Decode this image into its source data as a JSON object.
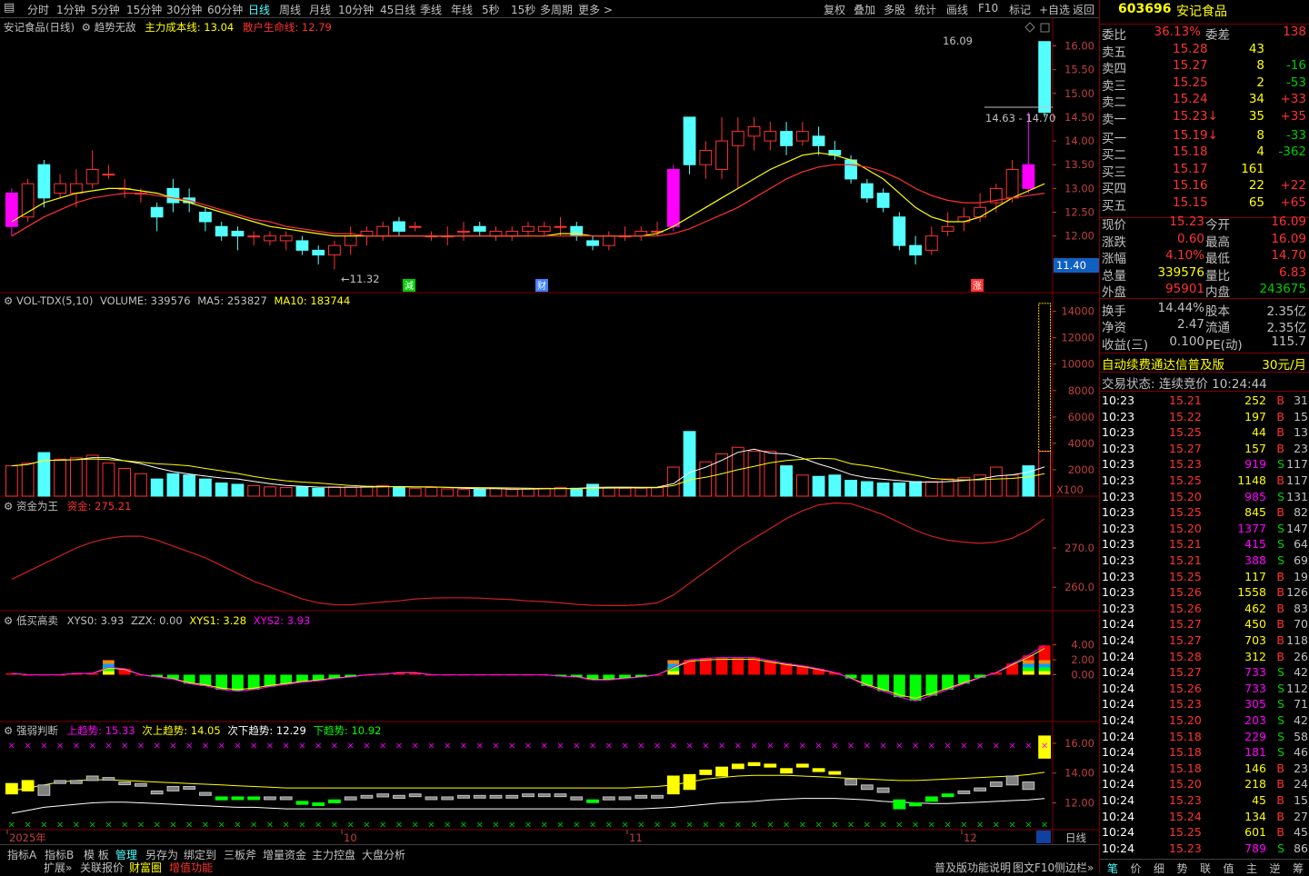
{
  "toolbar": {
    "periods": [
      "分时",
      "1分钟",
      "5分钟",
      "15分钟",
      "30分钟",
      "60分钟",
      "日线",
      "周线",
      "月线",
      "10分钟",
      "45日线",
      "季线",
      "年线",
      "5秒",
      "15秒",
      "多周期",
      "更多 >"
    ],
    "right": [
      "复权",
      "叠加",
      "多股",
      "统计",
      "画线",
      "F10",
      "标记",
      "+自选",
      "返回"
    ]
  },
  "main_panel": {
    "title": "安记食品(日线)",
    "indicator": "趋势无敌",
    "cost_line": "主力成本线: 13.04",
    "retail_line": "散户生命线: 12.79",
    "high_label": "16.09",
    "range_label": "14.63 - 14.70",
    "low_label": "←11.32",
    "price_box": "11.40",
    "markers": [
      "減",
      "财",
      "涨"
    ]
  },
  "vol_panel": {
    "title": "VOL-TDX(5,10)",
    "volume": "VOLUME: 339576",
    "ma5": "MA5: 253827",
    "ma10": "MA10: 183744",
    "unit": "X100"
  },
  "fund_panel": {
    "title": "资金为王",
    "fund": "资金: 275.21"
  },
  "low_panel": {
    "title": "低买高卖",
    "xys0": "XYS0: 3.93",
    "zzx": "ZZX: 0.00",
    "xys1": "XYS1: 3.28",
    "xys2": "XYS2: 3.93"
  },
  "strength_panel": {
    "title": "强弱判断",
    "up": "上趋势: 15.33",
    "next_up": "次上趋势: 14.05",
    "next_down": "次下趋势: 12.29",
    "down": "下趋势: 10.92"
  },
  "time_axis": {
    "labels": [
      "2025年",
      "10",
      "11",
      "12"
    ],
    "period": "日线"
  },
  "bottom_tabs": [
    "指标A",
    "指标B",
    "模 板",
    "管理",
    "另存为",
    "绑定到",
    "三板斧",
    "增量资金",
    "主力控盘",
    "大盘分析"
  ],
  "bottom_tabs2": [
    "扩展»",
    "关联报价",
    "财富圈",
    "增值功能"
  ],
  "bottom_right": [
    "普及版功能说明",
    "图文F10",
    "侧边栏»"
  ],
  "quote": {
    "code": "603696",
    "name": "安记食品",
    "webi": "委比",
    "webi_val": "36.13%",
    "weicha": "委差",
    "weicha_val": "138",
    "asks": [
      [
        "卖五",
        "15.28",
        "43",
        ""
      ],
      [
        "卖四",
        "15.27",
        "8",
        "-16"
      ],
      [
        "卖三",
        "15.25",
        "2",
        "-53"
      ],
      [
        "卖二",
        "15.24",
        "34",
        "+33"
      ],
      [
        "卖一",
        "15.23↓",
        "35",
        "+35"
      ]
    ],
    "bids": [
      [
        "买一",
        "15.19↓",
        "8",
        "-33"
      ],
      [
        "买二",
        "15.18",
        "4",
        "-362"
      ],
      [
        "买三",
        "15.17",
        "161",
        ""
      ],
      [
        "买四",
        "15.16",
        "22",
        "+22"
      ],
      [
        "买五",
        "15.15",
        "65",
        "+65"
      ]
    ],
    "stats": [
      [
        "现价",
        "15.23",
        "今开",
        "16.09"
      ],
      [
        "涨跌",
        "0.60",
        "最高",
        "16.09"
      ],
      [
        "涨幅",
        "4.10%",
        "最低",
        "14.70"
      ],
      [
        "总量",
        "339576",
        "量比",
        "6.83"
      ],
      [
        "外盘",
        "95901",
        "内盘",
        "243675"
      ]
    ],
    "stats2": [
      [
        "换手",
        "14.44%",
        "股本",
        "2.35亿"
      ],
      [
        "净资",
        "2.47",
        "流通",
        "2.35亿"
      ],
      [
        "收益(三)",
        "0.100",
        "PE(动)",
        "115.7"
      ]
    ],
    "ad": "自动续费通达信普及版",
    "ad_price": "30元/月",
    "status": "交易状态: 连续竞价 10:24:44",
    "ticks": [
      [
        "10:23",
        "15.21",
        "252",
        "B",
        "31"
      ],
      [
        "10:23",
        "15.22",
        "197",
        "B",
        "15"
      ],
      [
        "10:23",
        "15.25",
        "44",
        "B",
        "13"
      ],
      [
        "10:23",
        "15.27",
        "157",
        "B",
        "23"
      ],
      [
        "10:23",
        "15.23",
        "919",
        "S",
        "117"
      ],
      [
        "10:23",
        "15.25",
        "1148",
        "B",
        "117"
      ],
      [
        "10:23",
        "15.20",
        "985",
        "S",
        "131"
      ],
      [
        "10:23",
        "15.25",
        "845",
        "B",
        "82"
      ],
      [
        "10:23",
        "15.20",
        "1377",
        "S",
        "147"
      ],
      [
        "10:23",
        "15.21",
        "415",
        "S",
        "64"
      ],
      [
        "10:23",
        "15.21",
        "388",
        "S",
        "69"
      ],
      [
        "10:23",
        "15.25",
        "117",
        "B",
        "19"
      ],
      [
        "10:23",
        "15.26",
        "1558",
        "B",
        "126"
      ],
      [
        "10:23",
        "15.26",
        "462",
        "B",
        "83"
      ],
      [
        "10:24",
        "15.27",
        "450",
        "B",
        "70"
      ],
      [
        "10:24",
        "15.27",
        "703",
        "B",
        "118"
      ],
      [
        "10:24",
        "15.28",
        "312",
        "B",
        "26"
      ],
      [
        "10:24",
        "15.27",
        "733",
        "S",
        "42"
      ],
      [
        "10:24",
        "15.26",
        "733",
        "S",
        "112"
      ],
      [
        "10:24",
        "15.23",
        "305",
        "S",
        "71"
      ],
      [
        "10:24",
        "15.20",
        "203",
        "S",
        "42"
      ],
      [
        "10:24",
        "15.18",
        "229",
        "S",
        "58"
      ],
      [
        "10:24",
        "15.18",
        "181",
        "S",
        "46"
      ],
      [
        "10:24",
        "15.18",
        "146",
        "B",
        "23"
      ],
      [
        "10:24",
        "15.20",
        "218",
        "B",
        "24"
      ],
      [
        "10:24",
        "15.23",
        "45",
        "B",
        "15"
      ],
      [
        "10:24",
        "15.24",
        "134",
        "B",
        "27"
      ],
      [
        "10:24",
        "15.25",
        "601",
        "B",
        "45"
      ],
      [
        "10:24",
        "15.23",
        "789",
        "S",
        "86"
      ]
    ],
    "bottom_tabs": [
      "笔",
      "价",
      "细",
      "势",
      "联",
      "值",
      "主",
      "逆",
      "筹"
    ]
  },
  "colors": {
    "up": "#ff3232",
    "down": "#54ffff",
    "bg": "#000000",
    "grid": "#800000",
    "ma_yellow": "#ffff00",
    "ma_red": "#ff3232",
    "magenta": "#ff00ff"
  },
  "chart_data": {
    "type": "candlestick",
    "dates_axis": [
      "2025年",
      "10",
      "11",
      "12"
    ],
    "ylim": [
      11.0,
      16.2
    ],
    "yticks": [
      16.0,
      15.5,
      15.0,
      14.5,
      14.0,
      13.5,
      13.0,
      12.5,
      12.0
    ],
    "candles": [
      [
        12.2,
        12.9,
        13.0,
        12.0
      ],
      [
        12.4,
        13.1,
        13.2,
        12.3
      ],
      [
        13.5,
        12.8,
        13.6,
        12.6
      ],
      [
        12.9,
        13.1,
        13.3,
        12.8
      ],
      [
        12.9,
        13.1,
        13.4,
        12.6
      ],
      [
        13.1,
        13.4,
        13.8,
        13.0
      ],
      [
        13.3,
        13.3,
        13.5,
        13.2
      ],
      [
        13.0,
        13.0,
        13.2,
        12.8
      ],
      [
        12.9,
        12.9,
        13.0,
        12.7
      ],
      [
        12.6,
        12.4,
        12.7,
        12.1
      ],
      [
        13.0,
        12.7,
        13.2,
        12.5
      ],
      [
        12.8,
        12.7,
        13.0,
        12.5
      ],
      [
        12.5,
        12.3,
        12.6,
        12.1
      ],
      [
        12.2,
        12.0,
        12.3,
        11.9
      ],
      [
        12.1,
        12.0,
        12.2,
        11.7
      ],
      [
        12.0,
        12.0,
        12.1,
        11.8
      ],
      [
        11.9,
        12.0,
        12.1,
        11.8
      ],
      [
        11.9,
        12.0,
        12.1,
        11.7
      ],
      [
        11.9,
        11.7,
        12.0,
        11.6
      ],
      [
        11.7,
        11.6,
        11.8,
        11.4
      ],
      [
        11.6,
        11.8,
        11.9,
        11.3
      ],
      [
        11.8,
        12.0,
        12.2,
        11.6
      ],
      [
        12.0,
        12.1,
        12.2,
        11.8
      ],
      [
        12.0,
        12.2,
        12.3,
        11.9
      ],
      [
        12.3,
        12.1,
        12.4,
        12.0
      ],
      [
        12.2,
        12.2,
        12.3,
        12.1
      ],
      [
        12.0,
        12.0,
        12.1,
        11.9
      ],
      [
        12.0,
        12.0,
        12.2,
        11.8
      ],
      [
        12.1,
        12.1,
        12.3,
        11.9
      ],
      [
        12.2,
        12.1,
        12.3,
        12.0
      ],
      [
        12.0,
        12.1,
        12.2,
        11.9
      ],
      [
        12.0,
        12.1,
        12.2,
        11.9
      ],
      [
        12.1,
        12.2,
        12.3,
        12.0
      ],
      [
        12.1,
        12.2,
        12.3,
        12.0
      ],
      [
        12.2,
        12.2,
        12.4,
        12.0
      ],
      [
        12.2,
        12.0,
        12.3,
        11.9
      ],
      [
        11.9,
        11.8,
        12.0,
        11.7
      ],
      [
        11.8,
        12.0,
        12.1,
        11.7
      ],
      [
        12.0,
        12.0,
        12.2,
        11.9
      ],
      [
        12.0,
        12.1,
        12.2,
        11.9
      ],
      [
        12.1,
        12.1,
        12.3,
        12.0
      ],
      [
        12.2,
        13.4,
        13.5,
        12.1
      ],
      [
        14.5,
        13.5,
        14.5,
        13.3
      ],
      [
        13.5,
        13.8,
        14.0,
        13.2
      ],
      [
        13.4,
        14.0,
        14.5,
        13.2
      ],
      [
        13.9,
        14.2,
        14.5,
        13.0
      ],
      [
        14.1,
        14.3,
        14.5,
        13.8
      ],
      [
        14.0,
        14.2,
        14.4,
        13.8
      ],
      [
        14.2,
        13.9,
        14.4,
        13.7
      ],
      [
        14.0,
        14.2,
        14.4,
        13.9
      ],
      [
        14.1,
        13.9,
        14.3,
        13.7
      ],
      [
        13.8,
        13.7,
        14.0,
        13.6
      ],
      [
        13.6,
        13.2,
        13.7,
        13.1
      ],
      [
        13.1,
        12.8,
        13.2,
        12.7
      ],
      [
        12.9,
        12.6,
        13.0,
        12.5
      ],
      [
        12.4,
        11.8,
        12.5,
        11.7
      ],
      [
        11.8,
        11.6,
        12.0,
        11.4
      ],
      [
        11.7,
        12.0,
        12.2,
        11.6
      ],
      [
        12.1,
        12.2,
        12.5,
        12.0
      ],
      [
        12.3,
        12.4,
        12.6,
        12.1
      ],
      [
        12.4,
        12.6,
        12.9,
        12.3
      ],
      [
        12.7,
        13.0,
        13.1,
        12.5
      ],
      [
        12.8,
        13.4,
        13.6,
        12.7
      ],
      [
        13.5,
        13.0,
        14.6,
        12.9
      ],
      [
        14.6,
        16.09,
        16.09,
        14.5
      ]
    ],
    "ma_yellow": [
      12.3,
      12.5,
      12.7,
      12.8,
      12.9,
      12.95,
      13.0,
      13.0,
      12.95,
      12.9,
      12.8,
      12.7,
      12.6,
      12.5,
      12.4,
      12.3,
      12.2,
      12.15,
      12.1,
      12.05,
      12.0,
      12.0,
      12.0,
      12.0,
      12.0,
      12.0,
      12.0,
      12.0,
      12.0,
      12.0,
      12.0,
      12.0,
      12.0,
      12.0,
      12.05,
      12.05,
      12.0,
      12.0,
      12.0,
      12.0,
      12.05,
      12.2,
      12.4,
      12.6,
      12.8,
      13.0,
      13.2,
      13.4,
      13.55,
      13.7,
      13.75,
      13.7,
      13.6,
      13.4,
      13.2,
      12.9,
      12.6,
      12.4,
      12.3,
      12.3,
      12.4,
      12.6,
      12.8,
      12.95,
      13.1
    ],
    "ma_red": [
      12.0,
      12.2,
      12.4,
      12.55,
      12.7,
      12.8,
      12.85,
      12.9,
      12.9,
      12.85,
      12.8,
      12.75,
      12.65,
      12.55,
      12.45,
      12.35,
      12.3,
      12.2,
      12.15,
      12.1,
      12.05,
      12.05,
      12.0,
      12.0,
      12.0,
      12.0,
      12.0,
      12.0,
      12.0,
      12.0,
      12.0,
      12.0,
      12.0,
      12.0,
      12.0,
      12.0,
      12.0,
      12.0,
      12.0,
      12.0,
      12.0,
      12.05,
      12.15,
      12.3,
      12.45,
      12.6,
      12.8,
      13.0,
      13.2,
      13.35,
      13.45,
      13.5,
      13.5,
      13.45,
      13.35,
      13.2,
      13.0,
      12.85,
      12.75,
      12.7,
      12.7,
      12.75,
      12.8,
      12.85,
      12.9
    ],
    "volume": [
      2300,
      2500,
      3300,
      2800,
      2900,
      3100,
      2500,
      2100,
      1700,
      1300,
      1700,
      1600,
      1300,
      1000,
      900,
      800,
      700,
      650,
      700,
      600,
      700,
      700,
      750,
      800,
      700,
      600,
      650,
      550,
      500,
      550,
      600,
      500,
      550,
      600,
      650,
      600,
      900,
      650,
      600,
      600,
      650,
      2200,
      4900,
      2600,
      3200,
      3700,
      3400,
      3400,
      2300,
      1600,
      1500,
      1600,
      1200,
      1100,
      1000,
      1000,
      1100,
      1100,
      1300,
      1400,
      1600,
      2200,
      1600,
      2300,
      3396
    ],
    "vol_ylim": [
      0,
      14800
    ],
    "fund_ylim": [
      254,
      283
    ],
    "fund": [
      262,
      264,
      266,
      268,
      270,
      271.5,
      272.5,
      273,
      273,
      272,
      270.5,
      269,
      267.5,
      265.5,
      263.5,
      261.5,
      260,
      258.5,
      257,
      256,
      255.5,
      255.5,
      255.8,
      256.2,
      256.5,
      257,
      257.2,
      257.3,
      257.3,
      257.2,
      257,
      256.8,
      256.5,
      256.3,
      256,
      255.6,
      255.4,
      255.3,
      255.3,
      255.5,
      256,
      258,
      261,
      264,
      267,
      270,
      272.5,
      275,
      277.5,
      279.5,
      281,
      281.5,
      281.3,
      280,
      278.5,
      276.5,
      274.5,
      273,
      272,
      271.5,
      271.2,
      271.5,
      272.5,
      274.5,
      277.5
    ],
    "lowbuy_ylim": [
      -7,
      7
    ],
    "lowbuy": [
      0.2,
      0,
      0,
      0,
      0.2,
      0.2,
      1.0,
      0.8,
      0,
      -0.3,
      -0.6,
      -1.2,
      -1.5,
      -2.0,
      -2.2,
      -2.0,
      -1.6,
      -1.3,
      -1.0,
      -0.8,
      -0.5,
      -0.3,
      0,
      0.1,
      0.3,
      0.3,
      0,
      0,
      0,
      0,
      0,
      0,
      0,
      0,
      -0.2,
      -0.3,
      -0.7,
      -0.7,
      -0.5,
      -0.3,
      0,
      1.0,
      2.0,
      2.2,
      2.3,
      2.3,
      2.3,
      1.9,
      1.5,
      1.2,
      0.8,
      0.3,
      -0.5,
      -1.5,
      -2.2,
      -3.0,
      -3.5,
      -2.8,
      -2.0,
      -1.2,
      -0.4,
      0.3,
      1.5,
      2.6,
      3.93
    ],
    "strength_ylim": [
      10.2,
      17.4
    ],
    "strength_upper": [
      12.5,
      12.9,
      13.1,
      13.2,
      13.3,
      13.25,
      13.2,
      13.1,
      13.0,
      12.9,
      12.8,
      12.7,
      12.6,
      12.5,
      12.4,
      12.35,
      12.3,
      12.25,
      12.2,
      12.2,
      12.2,
      12.2,
      12.2,
      12.2,
      12.2,
      12.2,
      12.2,
      12.2,
      12.2,
      12.2,
      12.2,
      12.2,
      12.2,
      12.2,
      12.2,
      12.2,
      12.2,
      12.2,
      12.2,
      12.2,
      12.2,
      12.4,
      12.8,
      13.1,
      13.4,
      13.6,
      13.8,
      13.9,
      14.0,
      14.0,
      13.9,
      13.8,
      13.6,
      13.4,
      13.2,
      12.9,
      12.6,
      12.5,
      12.4,
      12.4,
      12.5,
      12.7,
      12.9,
      13.1,
      13.3
    ],
    "strength_lower": [
      11.3,
      11.5,
      11.7,
      11.8,
      11.9,
      12.0,
      12.05,
      12.05,
      12.0,
      11.95,
      11.9,
      11.85,
      11.8,
      11.75,
      11.7,
      11.7,
      11.65,
      11.6,
      11.6,
      11.6,
      11.6,
      11.6,
      11.6,
      11.6,
      11.6,
      11.6,
      11.6,
      11.6,
      11.6,
      11.6,
      11.6,
      11.6,
      11.6,
      11.6,
      11.6,
      11.6,
      11.6,
      11.6,
      11.6,
      11.6,
      11.65,
      11.7,
      11.8,
      11.9,
      12.0,
      12.05,
      12.1,
      12.2,
      12.25,
      12.3,
      12.3,
      12.3,
      12.25,
      12.2,
      12.1,
      12.05,
      12.0,
      11.95,
      11.95,
      12.0,
      12.05,
      12.1,
      12.15,
      12.2,
      12.29
    ],
    "strength_line2": [
      12.8,
      13.0,
      13.2,
      13.4,
      13.5,
      13.55,
      13.55,
      13.5,
      13.45,
      13.4,
      13.35,
      13.3,
      13.25,
      13.2,
      13.15,
      13.1,
      13.05,
      13.0,
      13.0,
      13.0,
      13.0,
      13.0,
      13.0,
      13.0,
      13.0,
      13.0,
      13.0,
      13.0,
      13.0,
      13.0,
      13.0,
      13.0,
      13.0,
      13.0,
      13.0,
      13.0,
      13.0,
      13.0,
      13.0,
      13.05,
      13.1,
      13.2,
      13.4,
      13.6,
      13.7,
      13.8,
      13.85,
      13.85,
      13.85,
      13.8,
      13.75,
      13.7,
      13.65,
      13.6,
      13.55,
      13.5,
      13.5,
      13.55,
      13.6,
      13.65,
      13.7,
      13.75,
      13.8,
      13.9,
      14.05
    ]
  }
}
